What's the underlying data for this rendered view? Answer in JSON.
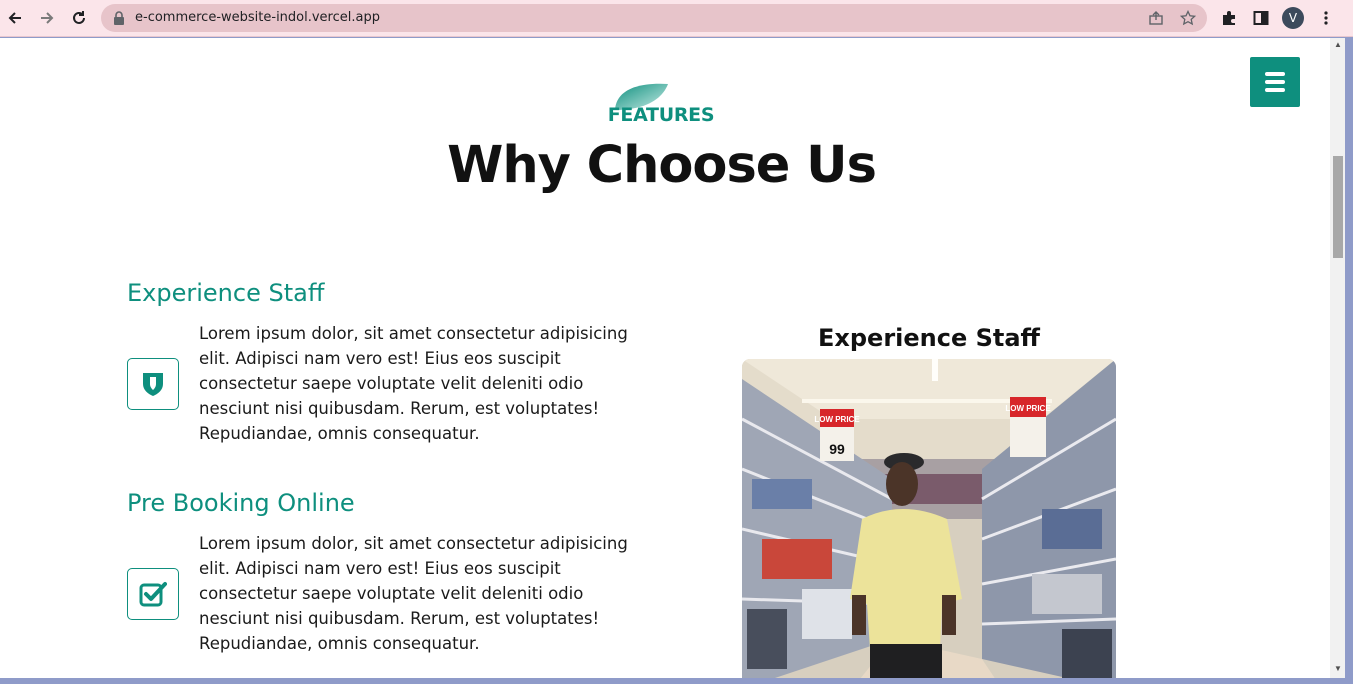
{
  "browser": {
    "url": "e-commerce-website-indol.vercel.app",
    "profile_initial": "V",
    "icons": [
      "back-icon",
      "forward-icon",
      "reload-icon",
      "lock-icon",
      "share-icon",
      "star-icon",
      "extensions-icon",
      "side-panel-icon",
      "kebab-menu-icon"
    ]
  },
  "page": {
    "eyebrow": "FEATURES",
    "title": "Why Choose Us",
    "accent_color": "#0e8f7e",
    "menu_icon": "hamburger-icon",
    "features": [
      {
        "heading": "Experience Staff",
        "icon": "shield-icon",
        "text": "Lorem ipsum dolor, sit amet consectetur adipisicing elit. Adipisci nam vero est! Eius eos suscipit consectetur saepe voluptate velit deleniti odio nesciunt nisi quibusdam. Rerum, est voluptates! Repudiandae, omnis consequatur."
      },
      {
        "heading": "Pre Booking Online",
        "icon": "checkbox-icon",
        "text": "Lorem ipsum dolor, sit amet consectetur adipisicing elit. Adipisci nam vero est! Eius eos suscipit consectetur saepe voluptate velit deleniti odio nesciunt nisi quibusdam. Rerum, est voluptates! Repudiandae, omnis consequatur."
      }
    ],
    "side_panel": {
      "title": "Experience Staff",
      "price_signs": [
        "LOW PRICE",
        "LOW PRICE"
      ],
      "price_value": "99"
    }
  }
}
